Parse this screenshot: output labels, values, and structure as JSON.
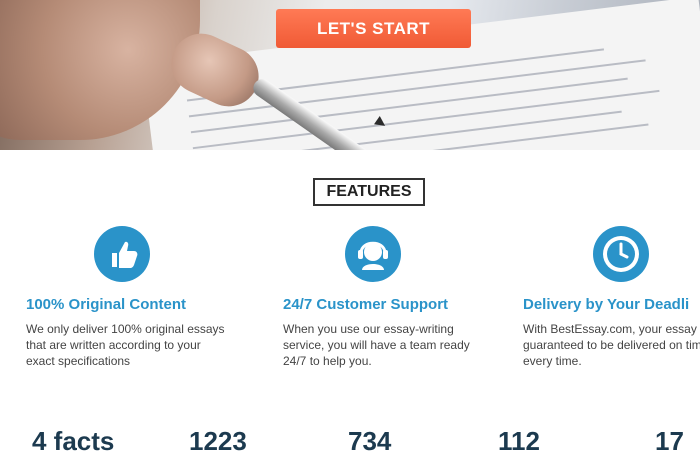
{
  "hero": {
    "cta_label": "LET'S START"
  },
  "section": {
    "title": "FEATURES"
  },
  "features": [
    {
      "icon": "thumbs-up-icon",
      "title": "100% Original Content",
      "desc": "We only deliver 100% original essays that are written according to your exact specifications"
    },
    {
      "icon": "headset-icon",
      "title": "24/7 Customer Support",
      "desc": "When you use our essay-writing service, you will have a team ready 24/7 to help you."
    },
    {
      "icon": "clock-icon",
      "title": "Delivery by Your Deadli",
      "desc": "With BestEssay.com, your essay guaranteed to be delivered on time, every time."
    }
  ],
  "stats": [
    "4 facts",
    "1223",
    "734",
    "112",
    "17"
  ],
  "colors": {
    "accent_blue": "#2a93c9",
    "cta_orange": "#f05a35",
    "stat_text": "#1c3a4f"
  }
}
